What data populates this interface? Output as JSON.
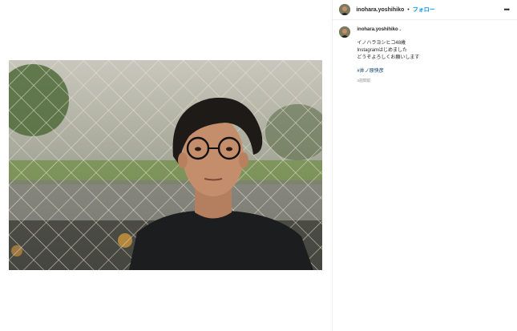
{
  "header": {
    "username": "inohara.yoshihiko",
    "separator": "•",
    "follow_label": "フォロー",
    "more_label": "•••"
  },
  "caption": {
    "username": "inohara.yoshihiko .",
    "text": "イノハラヨシヒコ48歳\nInstagramはじめました\nどうぞよろしくお願いします",
    "hashtag": "#井ノ原快彦",
    "timestamp": "4週間前"
  },
  "colors": {
    "accent": "#0095f6",
    "hashtag": "#00376b",
    "muted": "#8e8e8e"
  }
}
